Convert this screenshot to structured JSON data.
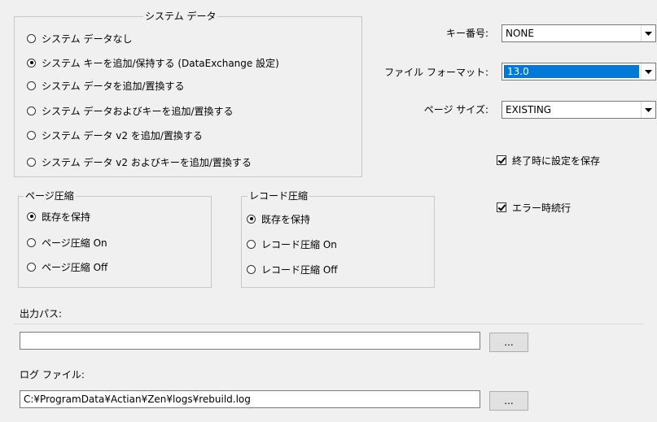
{
  "system_data": {
    "legend": "システム データ",
    "options": [
      {
        "label": "システム データなし",
        "selected": false
      },
      {
        "label": "システム キーを追加/保持する (DataExchange 設定)",
        "selected": true
      },
      {
        "label": "システム データを追加/置換する",
        "selected": false
      },
      {
        "label": "システム データおよびキーを追加/置換する",
        "selected": false
      },
      {
        "label": "システム データ v2 を追加/置換する",
        "selected": false
      },
      {
        "label": "システム データ v2 およびキーを追加/置換する",
        "selected": false
      }
    ]
  },
  "page_compression": {
    "legend": "ページ圧縮",
    "options": [
      {
        "label": "既存を保持",
        "selected": true
      },
      {
        "label": "ページ圧縮 On",
        "selected": false
      },
      {
        "label": "ページ圧縮 Off",
        "selected": false
      }
    ]
  },
  "record_compression": {
    "legend": "レコード圧縮",
    "options": [
      {
        "label": "既存を保持",
        "selected": true
      },
      {
        "label": "レコード圧縮 On",
        "selected": false
      },
      {
        "label": "レコード圧縮 Off",
        "selected": false
      }
    ]
  },
  "key_number": {
    "label": "キー番号:",
    "value": "NONE"
  },
  "file_format": {
    "label": "ファイル フォーマット:",
    "value": "13.0"
  },
  "page_size": {
    "label": "ページ サイズ:",
    "value": "EXISTING"
  },
  "save_settings": {
    "label": "終了時に設定を保存",
    "checked": true
  },
  "continue_on_error": {
    "label": "エラー時続行",
    "checked": true
  },
  "output_path": {
    "label": "出力パス:",
    "value": "",
    "browse_label": "..."
  },
  "log_file": {
    "label": "ログ ファイル:",
    "value": "C:¥ProgramData¥Actian¥Zen¥logs¥rebuild.log",
    "browse_label": "..."
  },
  "colors": {
    "selection": "#0078d7",
    "background": "#f0f0f0"
  }
}
